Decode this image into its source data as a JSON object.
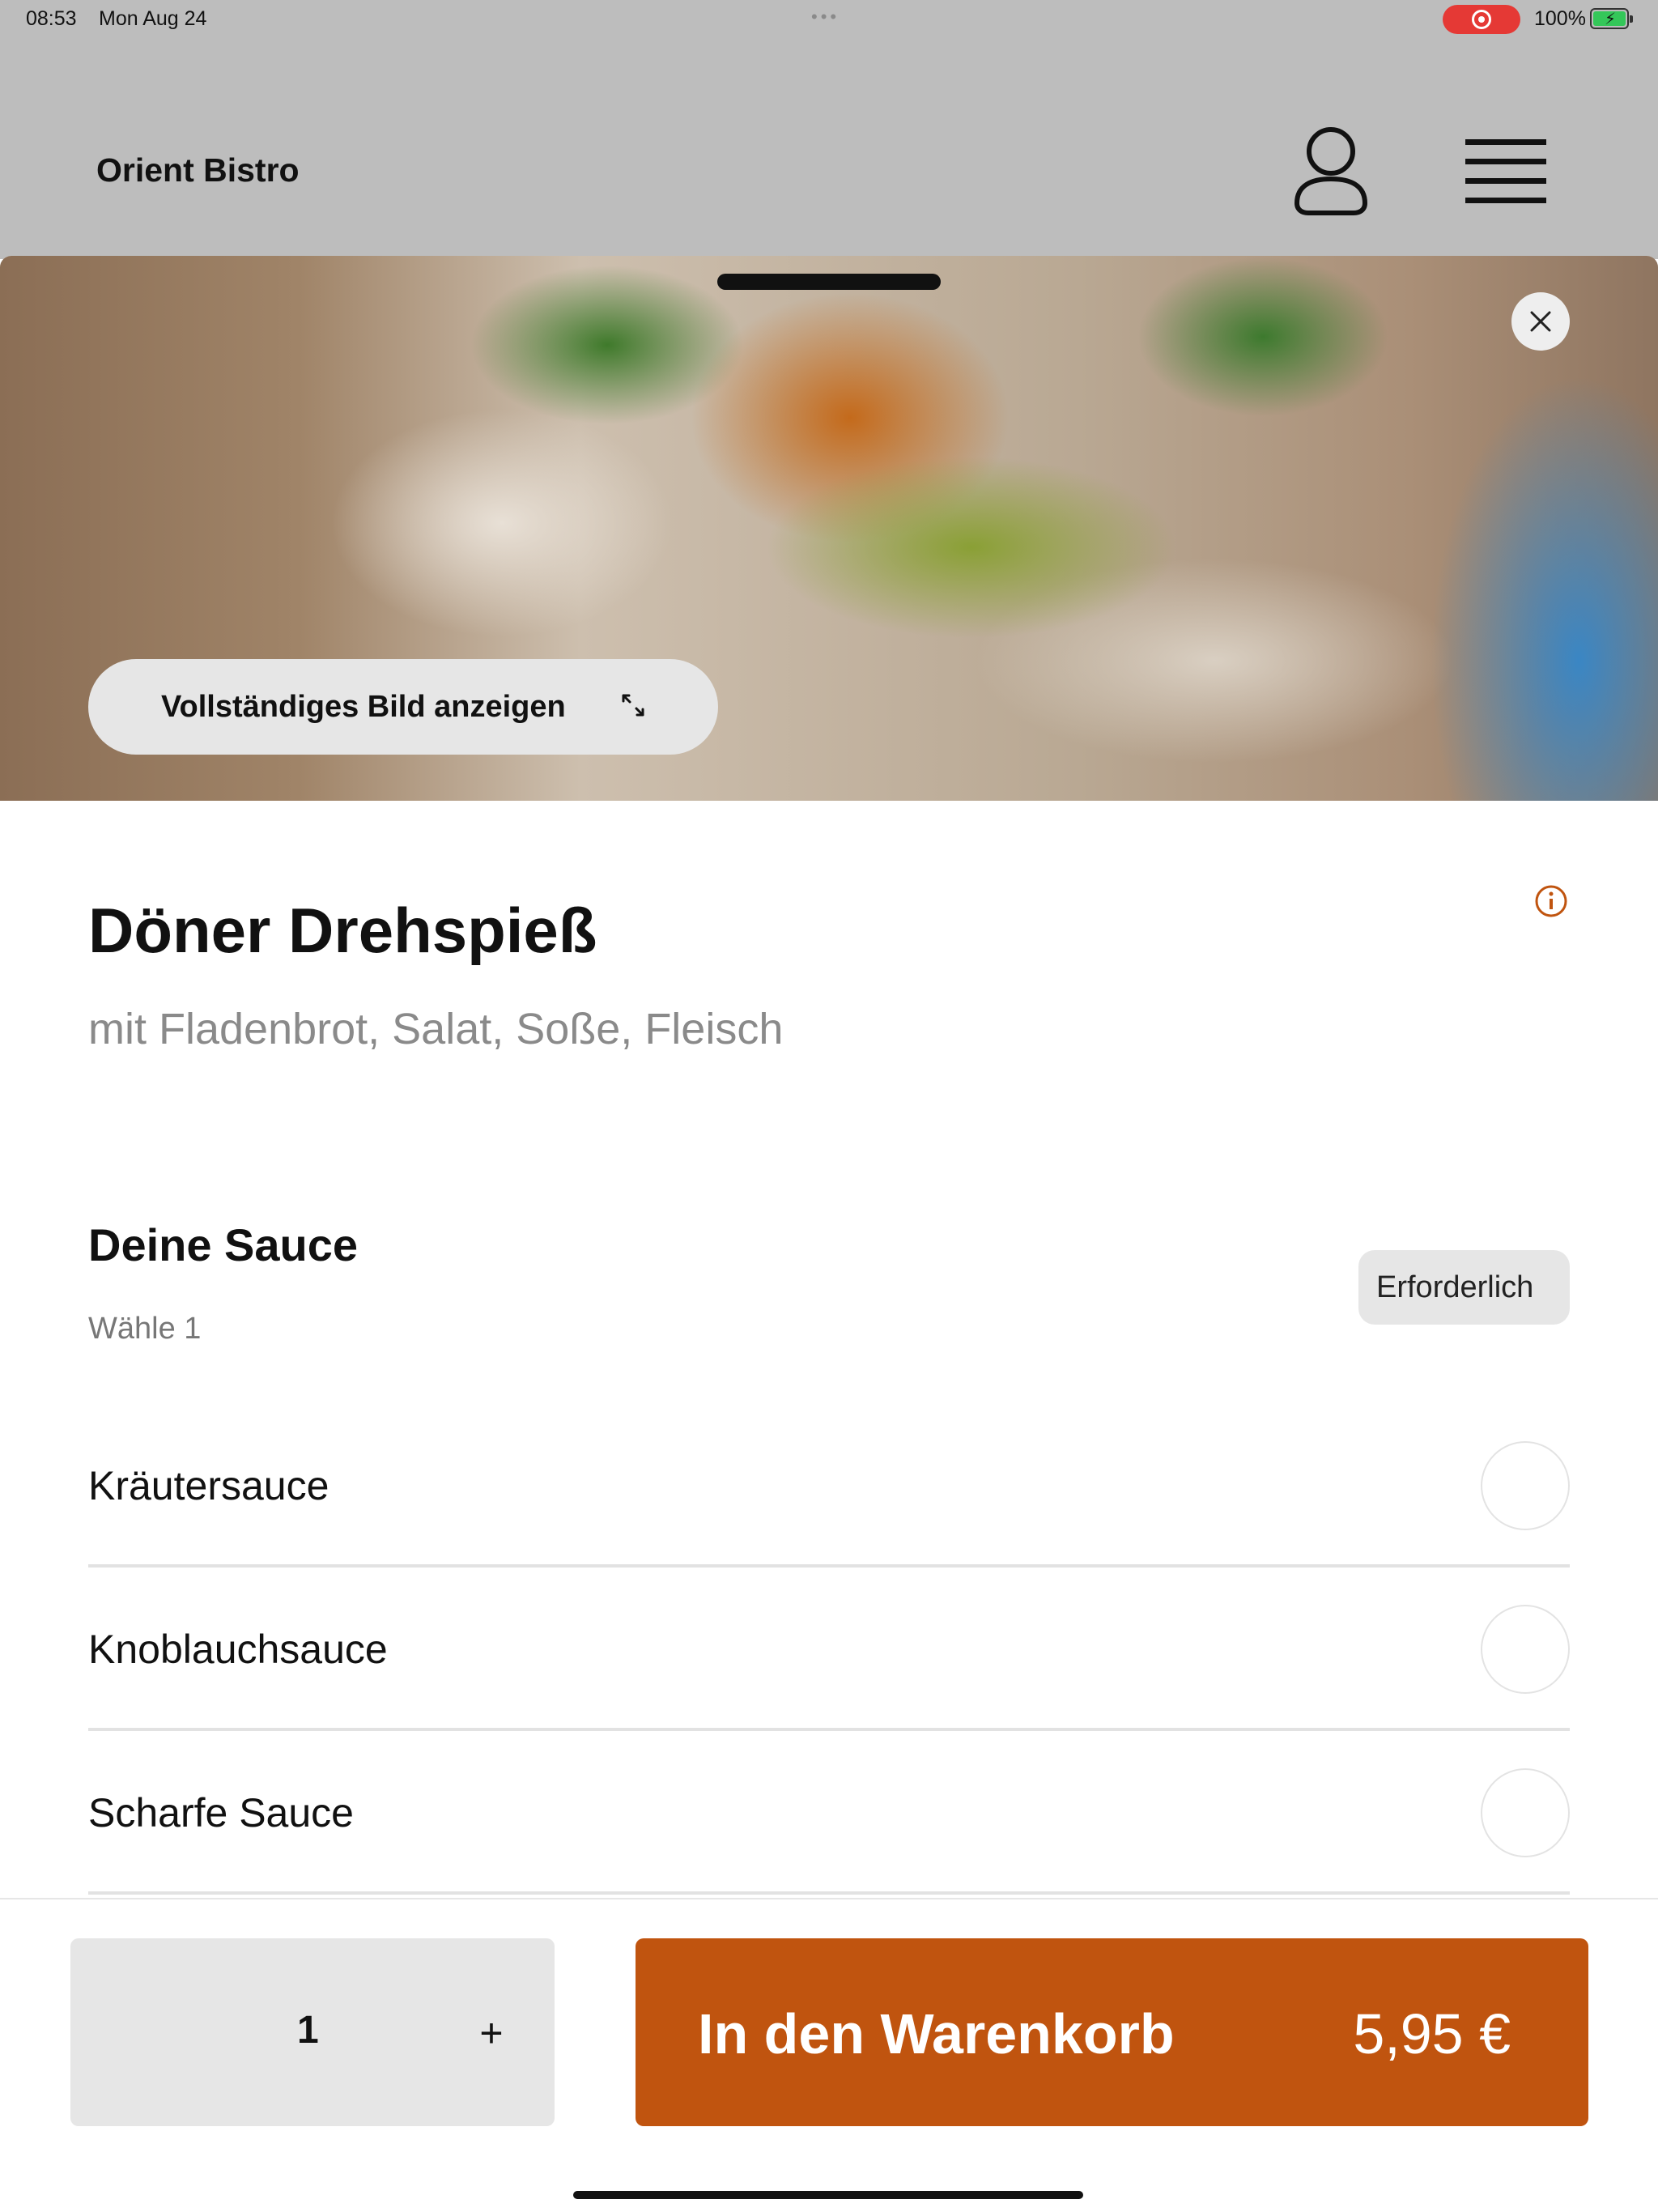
{
  "status_bar": {
    "time": "08:53",
    "date": "Mon Aug 24",
    "dots": "•••",
    "battery_percent": "100%"
  },
  "background_page": {
    "brand": "Orient Bistro",
    "icons": [
      "user-icon",
      "hamburger-menu-icon"
    ]
  },
  "product": {
    "full_image_label": "Vollständiges Bild anzeigen",
    "name": "Döner Drehspieß",
    "description": "mit Fladenbrot, Salat, Soße, Fleisch"
  },
  "sauce_section": {
    "title": "Deine Sauce",
    "hint": "Wähle 1",
    "badge": "Erforderlich",
    "options": [
      {
        "label": "Kräutersauce",
        "selected": false
      },
      {
        "label": "Knoblauchsauce",
        "selected": false
      },
      {
        "label": "Scharfe Sauce",
        "selected": false
      }
    ]
  },
  "footer": {
    "quantity": "1",
    "plus_label": "+",
    "cart_label": "In den Warenkorb",
    "price": "5,95 €"
  },
  "colors": {
    "accent": "#c0540f",
    "backdrop": "#bdbdbd",
    "neutral_button": "#e6e6e6"
  }
}
